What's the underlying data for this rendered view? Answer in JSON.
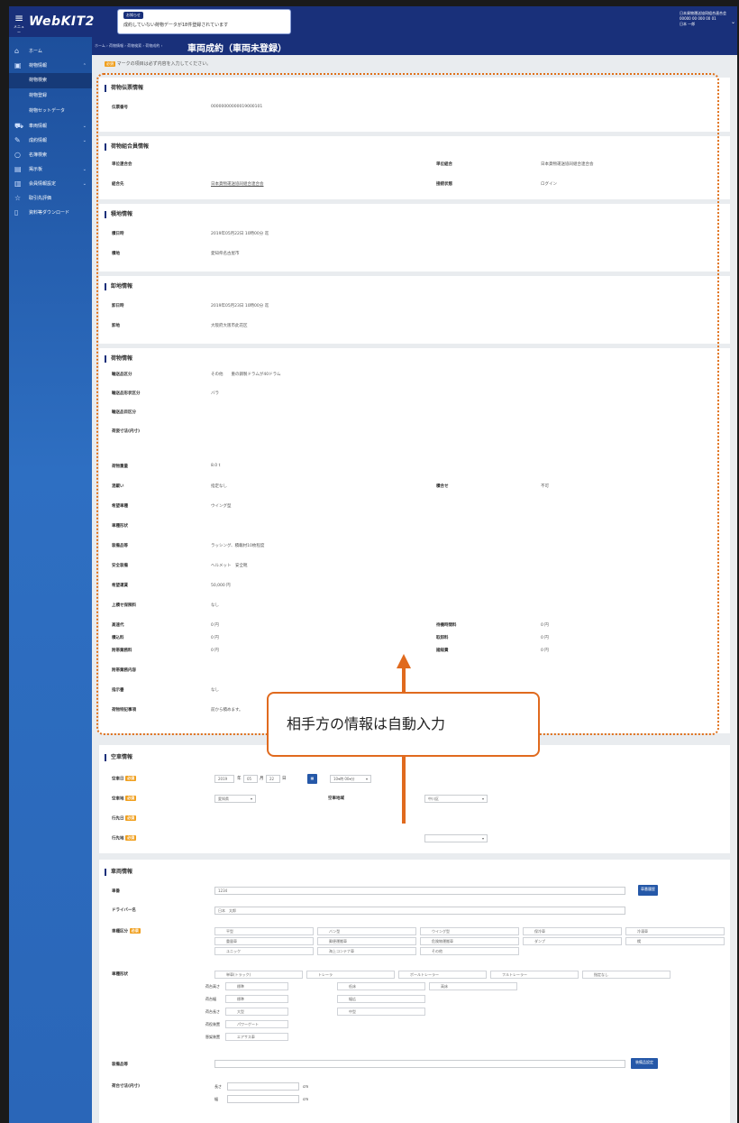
{
  "header": {
    "menu_label": "メニュー",
    "logo": "WebKIT2",
    "notice_tag": "お知らせ",
    "notice_text": "成約していない荷物データが18件登録されています",
    "user_line1": "日本貨物運送協同組合連合会",
    "user_line2": "00000 00 000 00 01",
    "user_line3": "日本 一郎"
  },
  "sidebar": {
    "items": [
      {
        "icon": "home-icon",
        "label": "ホーム"
      },
      {
        "icon": "box-icon",
        "label": "荷物情報"
      },
      {
        "label": "荷物検索"
      },
      {
        "label": "荷物登録"
      },
      {
        "label": "荷物セットデータ"
      },
      {
        "icon": "truck-icon",
        "label": "車両情報"
      },
      {
        "icon": "handshake-icon",
        "label": "成約情報"
      },
      {
        "icon": "search-icon",
        "label": "名簿検索"
      },
      {
        "icon": "board-icon",
        "label": "掲示板"
      },
      {
        "icon": "settings-icon",
        "label": "会員情報設定"
      },
      {
        "icon": "star-icon",
        "label": "取引先評価"
      },
      {
        "icon": "download-icon",
        "label": "資料等ダウンロード"
      }
    ]
  },
  "page": {
    "breadcrumb": "ホーム › 荷物情報 › 荷物検索 › 荷物成約 ›",
    "title": "車両成約（車両未登録）",
    "required_badge": "必須",
    "required_note": "マークの項目は必ず内容を入力してください。"
  },
  "cargo_reg": {
    "heading": "荷物伝票情報",
    "label": "伝票番号",
    "value": "00000000000019000101"
  },
  "union": {
    "heading": "荷物組合員情報",
    "l1": "単位連合会",
    "l2": "単位組合",
    "v2": "日本貨物運送協同組合連合会",
    "l3": "組合先",
    "v3": "日本貨物運送協同組合連合会",
    "l4": "接続状態",
    "v4": "ログイン"
  },
  "loading": {
    "heading": "積地情報",
    "l1": "積日時",
    "v1": "2019年05月22日 10時00分 迄",
    "l2": "積地",
    "v2": "愛知県名古屋市"
  },
  "unloading": {
    "heading": "卸地情報",
    "l1": "卸日時",
    "v1": "2019年05月23日 10時00分 迄",
    "l2": "卸地",
    "v2": "大阪府大阪市此花区"
  },
  "cargo": {
    "heading": "荷物情報",
    "rows": [
      {
        "label": "輸送品区分",
        "value": "その他　　重の鋼製ドラムが40ドラム"
      },
      {
        "label": "輸送品形状区分",
        "value": "バラ"
      },
      {
        "label": "輸送品目区分",
        "value": ""
      },
      {
        "label": "荷姿寸法(内寸)",
        "value": ""
      },
      {
        "label": "荷物重量",
        "value": "8.0 t"
      },
      {
        "label": "混載い",
        "value": "指定なし",
        "label2": "積合せ",
        "value2": "不可"
      },
      {
        "label": "希望車種",
        "value": "ウイング型"
      },
      {
        "label": "車種形状",
        "value": ""
      },
      {
        "label": "装備品等",
        "value": "ラッシング、積載材10枚程度"
      },
      {
        "label": "安全装備",
        "value": "ヘルメット　安全靴"
      },
      {
        "label": "希望運賃",
        "value": "50,000 円"
      },
      {
        "label": "上積せ保険料",
        "value": "なし"
      },
      {
        "label": "高速代",
        "value": "0 円",
        "label2": "待機時間料",
        "value2": "0 円"
      },
      {
        "label": "積込料",
        "value": "0 円",
        "label2": "取卸料",
        "value2": "0 円"
      },
      {
        "label": "附帯業務料",
        "value": "0 円",
        "label2": "諸経費",
        "value2": "0 円"
      },
      {
        "label": "附帯業務内容",
        "value": ""
      },
      {
        "label": "指示書",
        "value": "なし"
      },
      {
        "label": "荷物特記事項",
        "value": "前から積めます。"
      }
    ]
  },
  "empty": {
    "heading": "空車情報",
    "l1": "空車日",
    "date_year": "2019",
    "unit_year": "年",
    "date_month": "05",
    "unit_month": "月",
    "date_day": "22",
    "unit_day": "日",
    "time": "10▾時 00▾分",
    "l2": "空車地",
    "sel1": "愛知県",
    "l2b": "空車地域",
    "sel1b": "中川区",
    "l3": "行先日",
    "l4": "行先地"
  },
  "vehicle": {
    "heading": "車両情報",
    "l_number": "車番",
    "v_number": "1234",
    "btn_vehicle": "車番履歴",
    "l_driver": "ドライバー名",
    "v_driver": "日本　太郎",
    "l_type": "車種区分",
    "types": [
      "平型",
      "バン型",
      "ウイング型",
      "保冷車",
      "冷凍車",
      "重量車",
      "郵便運搬車",
      "危険物運搬車",
      "ダンプ",
      "幌",
      "ユニック",
      "海上コンテナ車",
      "その他"
    ],
    "l_shape": "車種形状",
    "shapes": [
      "単車(トラック)",
      "トレーラ",
      "ポールトレーラー",
      "フルトレーラー",
      "指定なし"
    ],
    "sub_rows": [
      {
        "label": "荷台高さ",
        "opts": [
          "標準",
          "低床",
          "高床"
        ]
      },
      {
        "label": "荷台幅",
        "opts": [
          "標準",
          "幅広"
        ]
      },
      {
        "label": "荷台長さ",
        "opts": [
          "大型",
          "中型"
        ]
      },
      {
        "label": "荷役装置",
        "opts": [
          "パワーゲート"
        ]
      },
      {
        "label": "懸架装置",
        "opts": [
          "エアサス車"
        ]
      }
    ],
    "l_equip": "装備品等",
    "btn_equip": "装備品設定",
    "l_dims": "荷台寸法(内寸)",
    "dim1": "長さ",
    "dim2": "幅",
    "unit": "cm"
  },
  "callout": {
    "text": "相手方の情報は自動入力"
  }
}
